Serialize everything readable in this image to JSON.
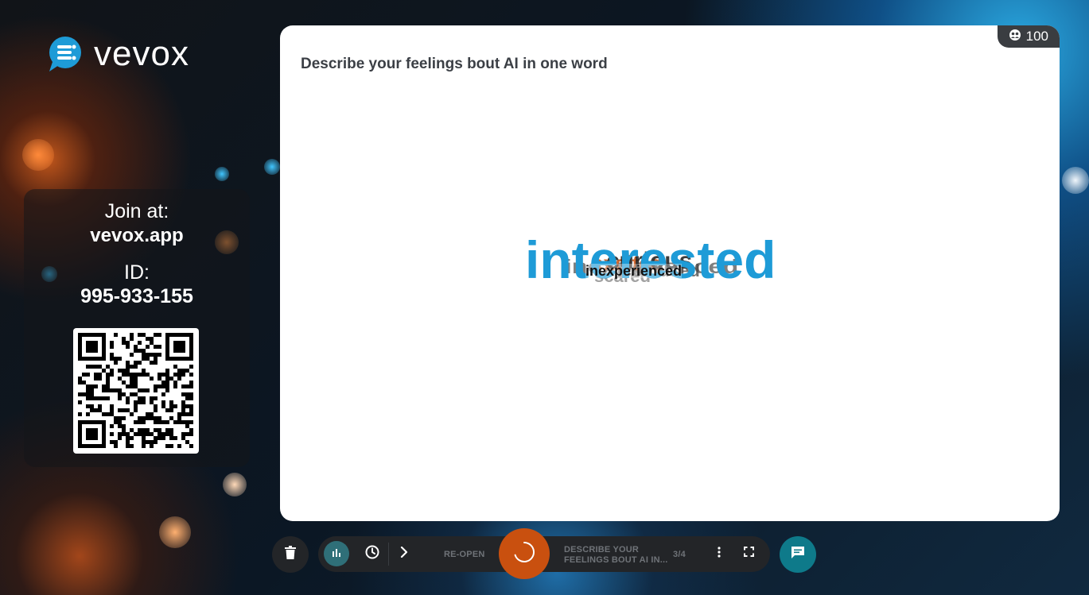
{
  "brand": {
    "name": "vevox",
    "accent": "#1e9bd7"
  },
  "join": {
    "label": "Join at:",
    "url": "vevox.app",
    "id_label": "ID:",
    "id_value": "995-933-155"
  },
  "card": {
    "question": "Describe your feelings bout AI in one word",
    "participant_count": "100",
    "participant_icon": "participants-icon"
  },
  "word_cloud": {
    "words": [
      {
        "text": "interested",
        "color": "#1e9bd7",
        "rank": 1
      },
      {
        "text": "inexperienced",
        "color": "#111111",
        "rank": 2
      },
      {
        "text": "excited",
        "color": "#c9500f",
        "rank": 3
      },
      {
        "text": "curious",
        "color": "#1b1b1b",
        "rank": 4
      },
      {
        "text": "scared",
        "color": "#8a8a8a",
        "rank": 5
      },
      {
        "text": "confused",
        "color": "#444444",
        "rank": 6
      }
    ]
  },
  "toolbar": {
    "delete_icon": "trash-icon",
    "results_icon": "bar-chart-icon",
    "timer_icon": "clock-icon",
    "next_icon": "chevron-right-icon",
    "reopen_label": "RE-OPEN",
    "current_question_line1": "DESCRIBE YOUR",
    "current_question_line2": "FEELINGS BOUT AI IN...",
    "position": "3/4",
    "more_icon": "more-vertical-icon",
    "fullscreen_icon": "fullscreen-icon",
    "chat_icon": "chat-icon",
    "colors": {
      "toolbar_bg": "#232528",
      "results_active": "#2f6f78",
      "center": "#c9500f",
      "chat": "#0e7a8a"
    }
  }
}
